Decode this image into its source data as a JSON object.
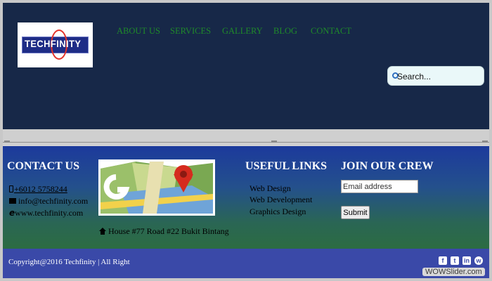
{
  "header": {
    "logo_text": "TECHFINITY",
    "nav": [
      "ABOUT US",
      "SERVICES",
      "GALLERY",
      "BLOG",
      "CONTACT"
    ],
    "search_placeholder": "Search..."
  },
  "footer": {
    "contact": {
      "heading": "CONTACT US",
      "phone": "+6012 5758244",
      "email": "info@techfinity.com",
      "website": "www.techfinity.com"
    },
    "address": "House #77 Road #22 Bukit Bintang",
    "useful_links": {
      "heading": "USEFUL LINKS",
      "items": [
        "Web Design",
        "Web Development",
        "Graphics Design"
      ]
    },
    "join": {
      "heading": "JOIN OUR CREW",
      "email_placeholder": "Email address",
      "submit_label": "Submit"
    }
  },
  "bottom": {
    "copyright": "Copyright@2016 Techfinity | All Right",
    "social": [
      "facebook-icon",
      "twitter-icon",
      "linkedin-icon",
      "wechat-icon"
    ],
    "watermark": "WOWSlider.com"
  },
  "colors": {
    "header_bg": "#172848",
    "nav_text": "#1f8a2a",
    "footer_top": "#1c3a9c",
    "footer_bottom": "#2c6c42",
    "copyright_bar": "#3a49a8"
  }
}
